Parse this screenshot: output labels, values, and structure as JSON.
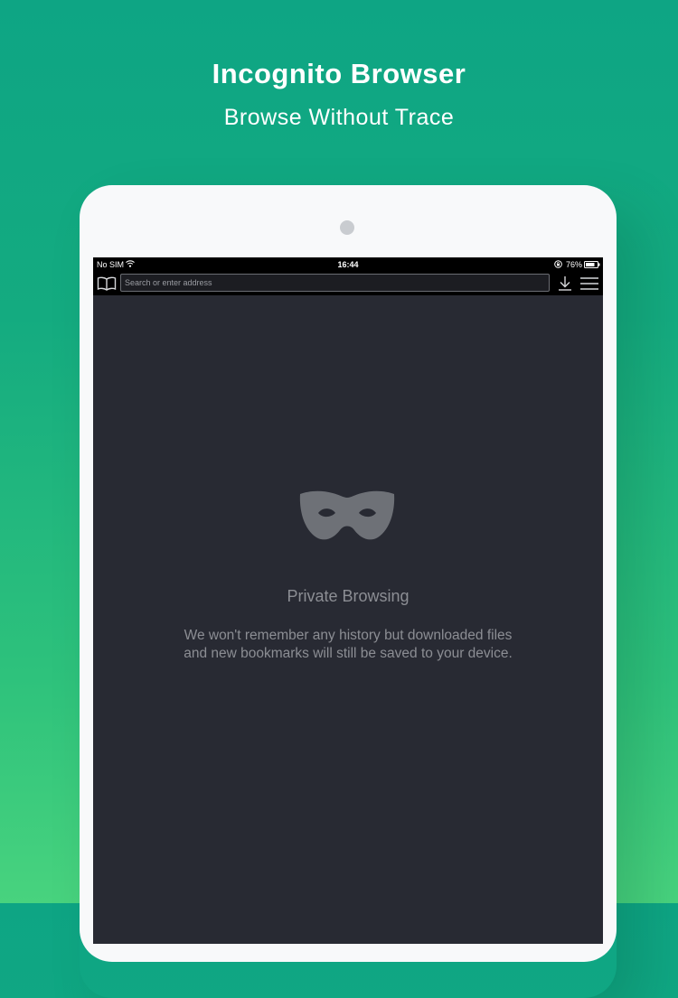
{
  "promo": {
    "title": "Incognito Browser",
    "subtitle": "Browse Without Trace"
  },
  "status_bar": {
    "carrier": "No SIM",
    "time": "16:44",
    "battery": "76%"
  },
  "toolbar": {
    "address_placeholder": "Search or enter address",
    "icons": [
      "bookmarks-icon",
      "download-icon",
      "menu-icon"
    ]
  },
  "private_browsing": {
    "icon": "mask-icon",
    "title": "Private Browsing",
    "description_line1": "We won't remember any history but downloaded files",
    "description_line2": "and new bookmarks will still be saved to your device."
  },
  "colors": {
    "background_top": "#0ea584",
    "background_bottom": "#48d37e",
    "screen": "#282a33",
    "muted_text": "#8c8e94"
  }
}
